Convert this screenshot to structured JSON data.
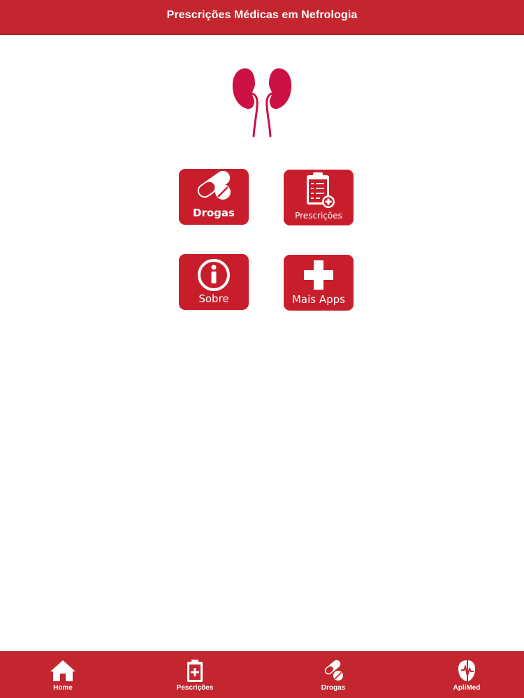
{
  "header": {
    "title": "Prescrições Médicas em Nefrologia"
  },
  "menu": {
    "drogas": "Drogas",
    "prescricoes": "Prescrições",
    "sobre": "Sobre",
    "mais_apps": "Mais Apps"
  },
  "tabbar": {
    "home": "Home",
    "prescricoes": "Pescrições",
    "drogas": "Drogas",
    "aplimed": "ApliMed"
  },
  "icons": {
    "logo": "kidneys-icon",
    "drogas": "pills-icon",
    "prescricoes": "clipboard-checklist-icon",
    "sobre": "info-icon",
    "mais_apps": "plus-icon",
    "tab_home": "home-icon",
    "tab_prescricoes": "clipboard-plus-icon",
    "tab_drogas": "pills-icon",
    "tab_aplimed": "aplimed-logo-icon"
  },
  "colors": {
    "brand_red": "#c3262e",
    "tile_red": "#c81e2c",
    "kidney_red": "#cc1144",
    "background": "#ffffff",
    "text_light": "#ffffff"
  }
}
